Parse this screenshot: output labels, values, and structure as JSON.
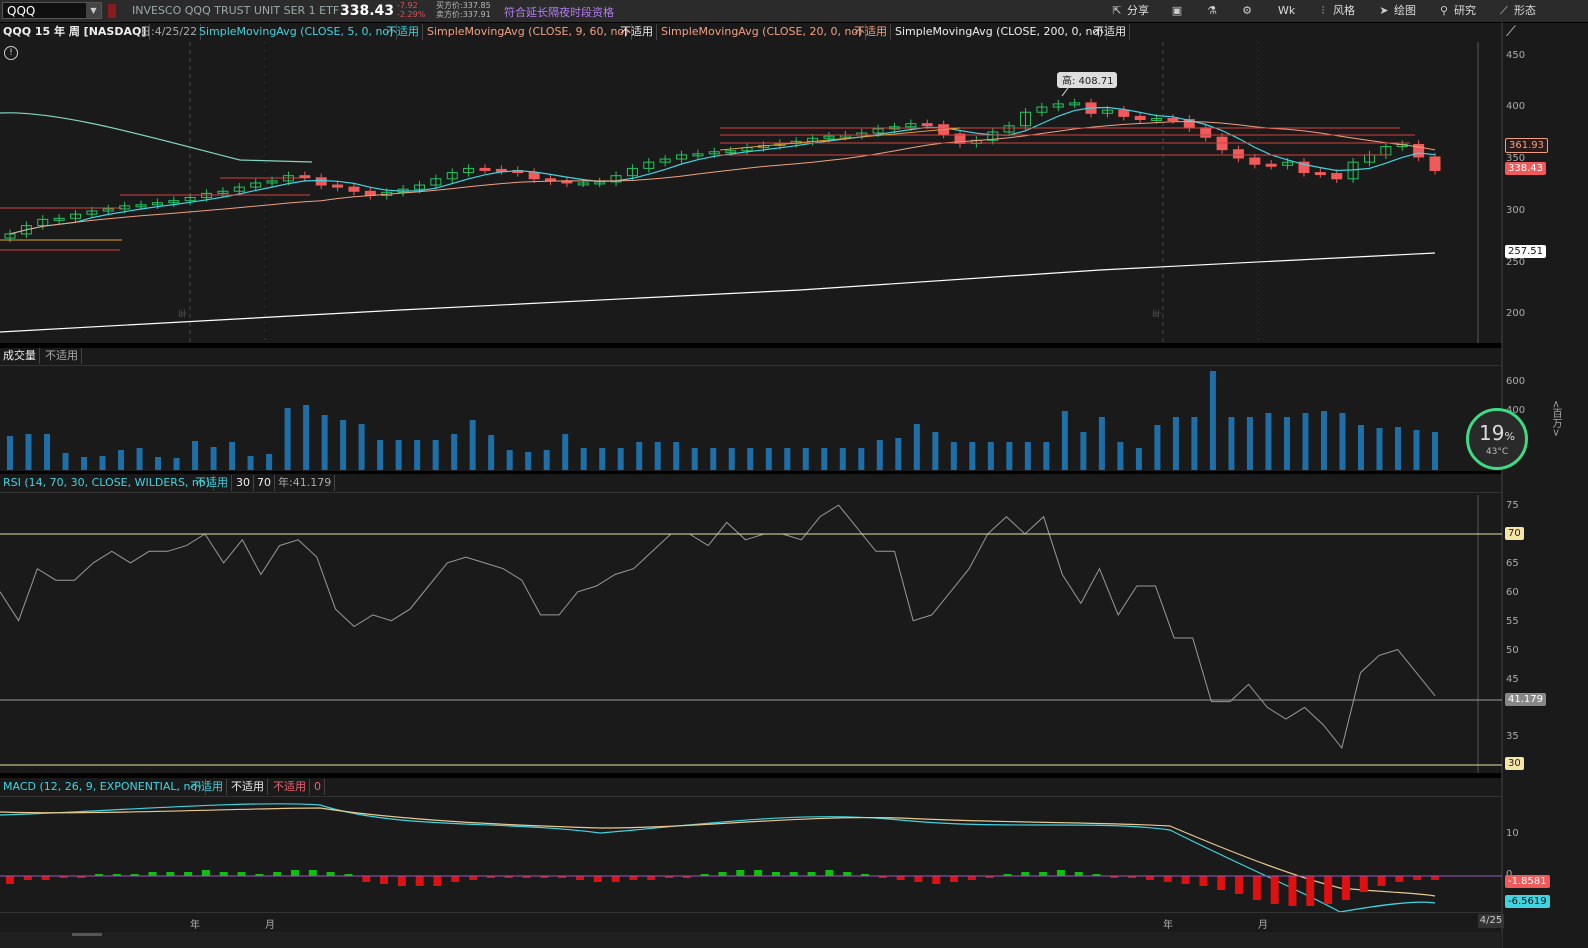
{
  "toolbar": {
    "symbol": "QQQ",
    "instrument": "INVESCO QQQ TRUST UNIT SER 1 ETF",
    "last_price": "338.43",
    "change_abs": "-7.92",
    "change_pct": "-2.29%",
    "bid": "买方价:337.85",
    "ask": "卖方价:337.91",
    "ext_hours": "符合延长隔夜时段资格",
    "share_label": "分享",
    "period_label": "Wk",
    "style_label": "风格",
    "drawings_label": "绘图",
    "studies_label": "研究",
    "patterns_label": "形态"
  },
  "price_panel": {
    "title": "QQQ 15 年 周 [NASDAQ]",
    "date_label": "日:4/25/22",
    "studies": [
      {
        "name": "SimpleMovingAvg (CLOSE, 5, 0, no)",
        "value": "不适用"
      },
      {
        "name": "SimpleMovingAvg (CLOSE, 9, 60, no)",
        "value": "不适用"
      },
      {
        "name": "SimpleMovingAvg (CLOSE, 20, 0, no)",
        "value": "不适用"
      },
      {
        "name": "SimpleMovingAvg (CLOSE, 200, 0, no)",
        "value": "不适用"
      }
    ],
    "high_callout": "高: 408.71",
    "year_label": "年",
    "y_ticks": [
      "450",
      "400",
      "350",
      "300",
      "250",
      "200"
    ],
    "tags": {
      "sma9": "361.93",
      "last": "338.43",
      "sma200": "257.51"
    }
  },
  "volume_panel": {
    "title": "成交量",
    "value": "不适用",
    "y_ticks": [
      "600",
      "400"
    ],
    "unit": "<百万>"
  },
  "rsi_panel": {
    "title": "RSI (14, 70, 30, CLOSE, WILDERS, no)",
    "value": "不适用",
    "ob": "30",
    "os": "70",
    "current": "年:41.179",
    "y_ticks": [
      "75",
      "65",
      "60",
      "55",
      "50",
      "45",
      "40",
      "35"
    ],
    "tags": {
      "upper": "70",
      "cur": "41.179",
      "lower": "30"
    }
  },
  "macd_panel": {
    "title": "MACD (12, 26, 9, EXPONENTIAL, no)",
    "v1": "不适用",
    "v2": "不适用",
    "v3": "不适用",
    "v4": "0",
    "y_ticks": [
      "10",
      "0"
    ],
    "tags": {
      "diff": "-1.8581",
      "avg": "-6.5619"
    }
  },
  "x_axis": {
    "labels": [
      "年",
      "月",
      "年",
      "月"
    ],
    "date_box": "4/25"
  },
  "widget": {
    "percent": "19",
    "pct_sign": "%",
    "temp": "43°C"
  },
  "colors": {
    "up": "#22c55e",
    "down": "#f05a5a",
    "sma5": "#3fd4e0",
    "sma20": "#f0a080",
    "sma200": "#ffffff",
    "rsi": "#999999",
    "rsi_ob": "#f06070",
    "vol": "#1e6fa8",
    "macd": "#3fd4e0",
    "signal": "#e8c890"
  }
}
